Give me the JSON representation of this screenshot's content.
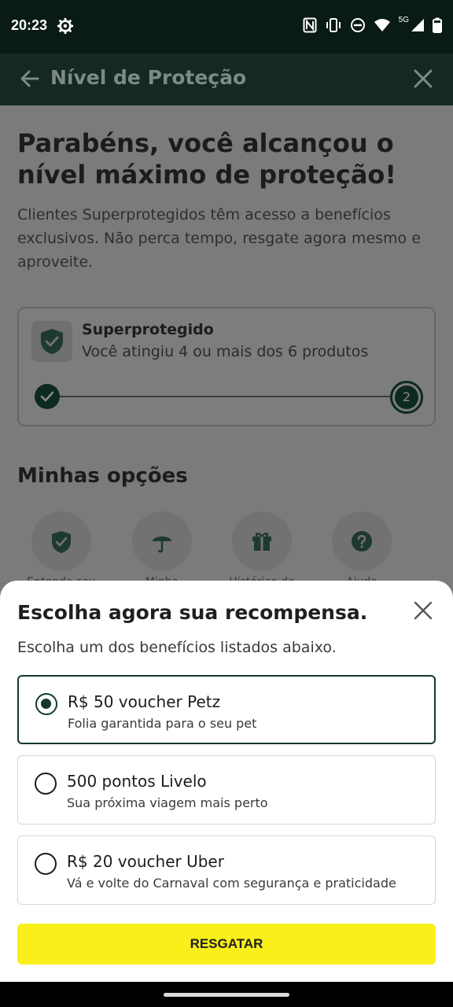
{
  "status_bar": {
    "time": "20:23",
    "icons": [
      "gear-icon",
      "nfc-icon",
      "vibrate-icon",
      "dnd-icon",
      "wifi-icon",
      "5g-signal-icon",
      "battery-icon"
    ],
    "network": "5G"
  },
  "app_bar": {
    "title": "Nível de Proteção",
    "back_icon": "back-arrow-icon",
    "close_icon": "close-icon"
  },
  "content": {
    "hero_title": "Parabéns, você alcançou o nível máximo de proteção!",
    "hero_desc": "Clientes Superprotegidos têm acesso a benefícios exclusivos. Não perca tempo, resgate agora mesmo e aproveite.",
    "level_card": {
      "name": "Superprotegido",
      "subtitle": "Você atingiu 4 ou mais dos 6 produtos",
      "current_step": "2"
    },
    "section_title": "Minhas opções",
    "options": [
      {
        "label": "Entenda seu",
        "icon": "shield-check-icon"
      },
      {
        "label": "Minha",
        "icon": "umbrella-icon"
      },
      {
        "label": "Histórico de",
        "icon": "gift-icon"
      },
      {
        "label": "Ajuda",
        "icon": "help-icon"
      }
    ]
  },
  "sheet": {
    "title": "Escolha agora sua recompensa.",
    "subtitle": "Escolha um dos benefícios listados abaixo.",
    "rewards": [
      {
        "title": "R$ 50 voucher Petz",
        "desc": "Folia garantida para o seu pet",
        "selected": true
      },
      {
        "title": "500 pontos Livelo",
        "desc": "Sua próxima viagem mais perto",
        "selected": false
      },
      {
        "title": "R$ 20 voucher Uber",
        "desc": "Vá e volte do Carnaval com segurança e praticidade",
        "selected": false
      }
    ],
    "button_label": "RESGATAR"
  },
  "colors": {
    "accent_dark_green": "#16392a",
    "button_yellow": "#f8ef1b",
    "app_bar_bg": "#142a20"
  }
}
